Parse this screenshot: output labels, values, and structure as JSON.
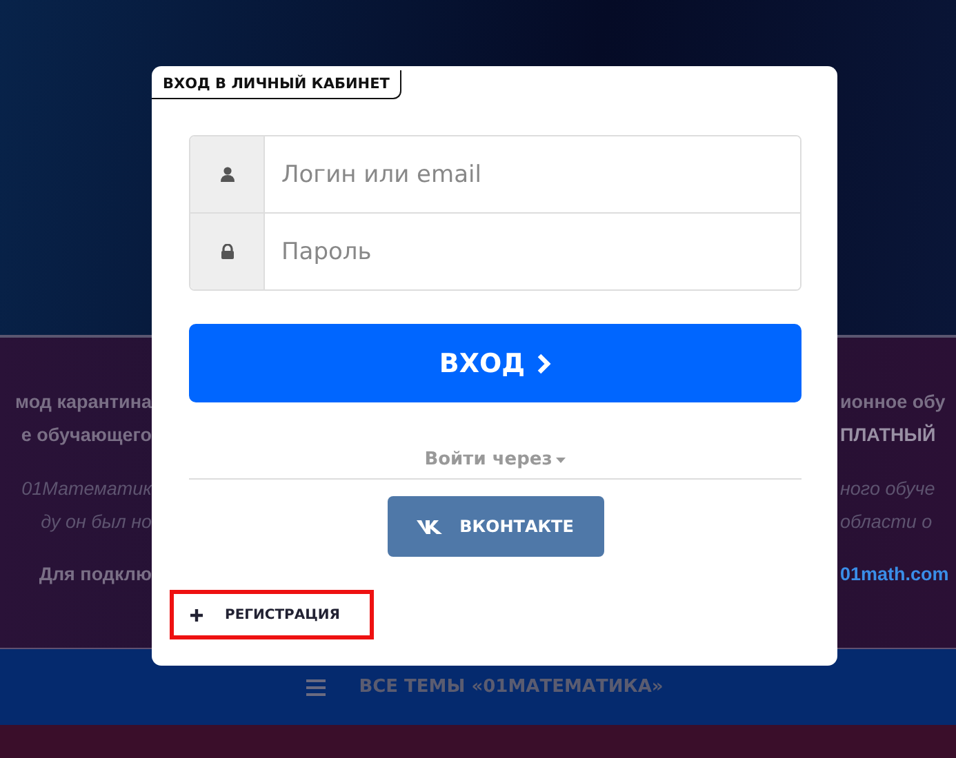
{
  "background": {
    "lines": [
      {
        "left": "мод карантина",
        "right": "ионное обу",
        "kind": "plain"
      },
      {
        "left": "е обучающего",
        "right": "ПЛАТНЫЙ",
        "kind": "plain"
      },
      {
        "left": "01Математик",
        "right": "ного обуче",
        "kind": "italic"
      },
      {
        "left": "ду он был но",
        "right": "области о",
        "kind": "italic"
      },
      {
        "left": "Для подклю",
        "right": "01math.com",
        "kind": "link"
      }
    ],
    "nav_bar": {
      "label": "ВСЕ ТЕМЫ «01МАТЕМАТИКА»"
    }
  },
  "login_dialog": {
    "title": "ВХОД В ЛИЧНЫЙ КАБИНЕТ",
    "fields": [
      {
        "kind": "user",
        "placeholder": "Логин или email"
      },
      {
        "kind": "password",
        "placeholder": "Пароль"
      }
    ],
    "submit": {
      "label": "ВХОД"
    },
    "social_heading": "Войти через",
    "social_buttons": [
      {
        "label": "ВКОНТАКТЕ"
      }
    ],
    "register": {
      "label": "РЕГИСТРАЦИЯ",
      "highlighted": true
    }
  }
}
